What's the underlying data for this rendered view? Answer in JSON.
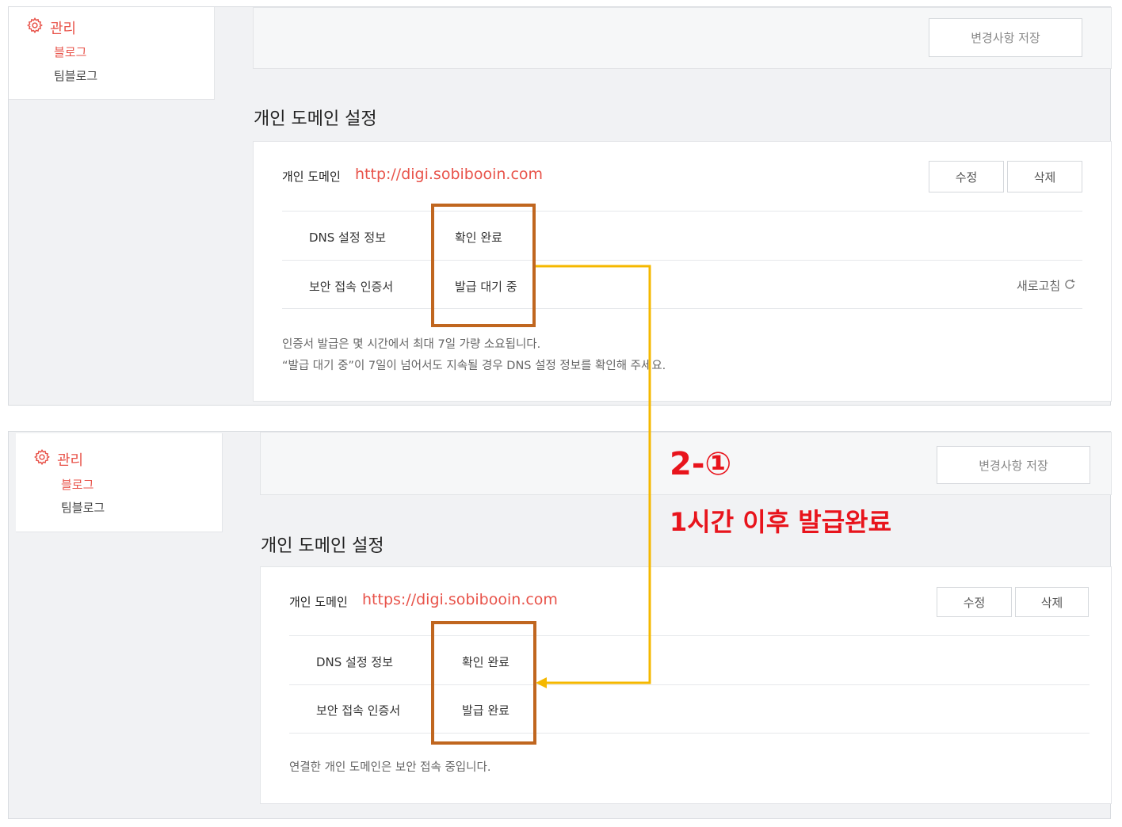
{
  "top": {
    "sidebar": {
      "heading": "관리",
      "items": [
        {
          "label": "블로그",
          "active": true
        },
        {
          "label": "팀블로그",
          "active": false
        }
      ]
    },
    "save_button": "변경사항 저장",
    "section_title": "개인 도메인 설정",
    "domain_label": "개인 도메인",
    "domain_url": "http://digi.sobibooin.com",
    "edit_button": "수정",
    "delete_button": "삭제",
    "rows": [
      {
        "label": "DNS 설정 정보",
        "value": "확인 완료"
      },
      {
        "label": "보안 접속 인증서",
        "value": "발급 대기 중"
      }
    ],
    "refresh_label": "새로고침",
    "notes": [
      "인증서 발급은 몇 시간에서 최대 7일 가량 소요됩니다.",
      "“발급 대기 중”이 7일이 넘어서도 지속될 경우 DNS 설정 정보를 확인해 주세요."
    ]
  },
  "bottom": {
    "sidebar": {
      "heading": "관리",
      "items": [
        {
          "label": "블로그",
          "active": true
        },
        {
          "label": "팀블로그",
          "active": false
        }
      ]
    },
    "save_button": "변경사항 저장",
    "section_title": "개인 도메인 설정",
    "domain_label": "개인 도메인",
    "domain_url": "https://digi.sobibooin.com",
    "edit_button": "수정",
    "delete_button": "삭제",
    "rows": [
      {
        "label": "DNS 설정 정보",
        "value": "확인 완료"
      },
      {
        "label": "보안 접속 인증서",
        "value": "발급 완료"
      }
    ],
    "notes": [
      "연결한 개인 도메인은 보안 접속 중입니다."
    ]
  },
  "annotation": {
    "step": "2-①",
    "caption": "1시간 이후 발급완료"
  },
  "colors": {
    "accent": "#e8534a",
    "highlight_box": "#c0661f",
    "arrow": "#f5b800",
    "annotation": "#e8141c"
  }
}
